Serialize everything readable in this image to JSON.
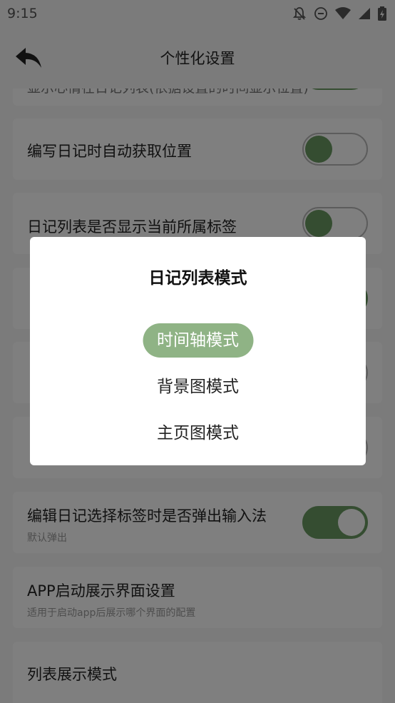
{
  "status_bar": {
    "time": "9:15"
  },
  "app_bar": {
    "title": "个性化设置"
  },
  "settings": [
    {
      "title": "显示心情在日记列表(依据设置的时间显示位置)",
      "subtitle": "",
      "toggle": true
    },
    {
      "title": "编写日记时自动获取位置",
      "subtitle": "",
      "toggle": false
    },
    {
      "title": "日记列表是否显示当前所属标签",
      "subtitle": "",
      "toggle": false
    },
    {
      "title": "",
      "subtitle": "",
      "toggle": true
    },
    {
      "title": "",
      "subtitle": "",
      "toggle": false
    },
    {
      "title": "",
      "subtitle": "",
      "toggle": false
    },
    {
      "title": "编辑日记选择标签时是否弹出输入法",
      "subtitle": "默认弹出",
      "toggle": true
    },
    {
      "title": "APP启动展示界面设置",
      "subtitle": "适用于启动app后展示哪个界面的配置"
    },
    {
      "title": "列表展示模式",
      "subtitle": ""
    }
  ],
  "dialog": {
    "title": "日记列表模式",
    "options": [
      {
        "label": "时间轴模式",
        "selected": true
      },
      {
        "label": "背景图模式",
        "selected": false
      },
      {
        "label": "主页图模式",
        "selected": false
      }
    ]
  },
  "colors": {
    "accent": "#6a9a62",
    "selected_option_bg": "#8fb385"
  }
}
